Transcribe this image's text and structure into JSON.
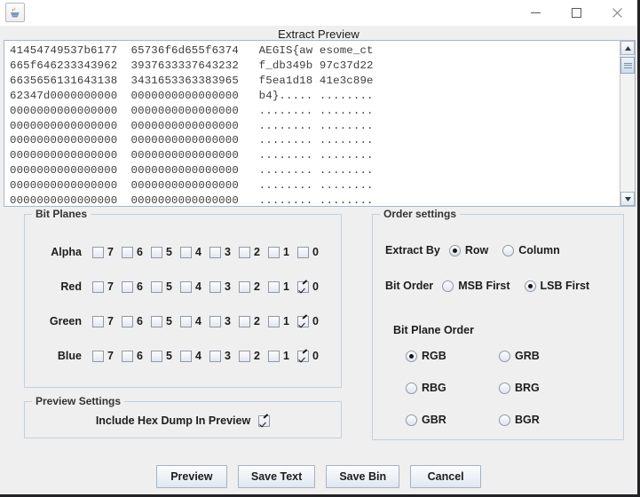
{
  "window": {
    "app_icon": "java-coffee-cup-icon",
    "title": "Extract Preview",
    "controls": {
      "minimize": "minimize-icon",
      "maximize": "maximize-icon",
      "close": "close-icon"
    }
  },
  "hexdump": {
    "lines": [
      "41454749537b6177  65736f6d655f6374   AEGIS{aw esome_ct",
      "665f646233343962  3937633337643232   f_db349b 97c37d22",
      "6635656131643138  3431653363383965   f5ea1d18 41e3c89e",
      "62347d0000000000  0000000000000000   b4}..... ........",
      "0000000000000000  0000000000000000   ........ ........",
      "0000000000000000  0000000000000000   ........ ........",
      "0000000000000000  0000000000000000   ........ ........",
      "0000000000000000  0000000000000000   ........ ........",
      "0000000000000000  0000000000000000   ........ ........",
      "0000000000000000  0000000000000000   ........ ........",
      "0000000000000000  0000000000000000   ........ ........"
    ],
    "scrollbar": {
      "up_arrow": "scroll-up-arrow-icon",
      "down_arrow": "scroll-down-arrow-icon"
    }
  },
  "bit_planes": {
    "legend": "Bit Planes",
    "bits": [
      "7",
      "6",
      "5",
      "4",
      "3",
      "2",
      "1",
      "0"
    ],
    "channels": [
      {
        "label": "Alpha",
        "checked": [
          false,
          false,
          false,
          false,
          false,
          false,
          false,
          false
        ]
      },
      {
        "label": "Red",
        "checked": [
          false,
          false,
          false,
          false,
          false,
          false,
          false,
          true
        ]
      },
      {
        "label": "Green",
        "checked": [
          false,
          false,
          false,
          false,
          false,
          false,
          false,
          true
        ]
      },
      {
        "label": "Blue",
        "checked": [
          false,
          false,
          false,
          false,
          false,
          false,
          false,
          true
        ]
      }
    ]
  },
  "order_settings": {
    "legend": "Order settings",
    "extract_by": {
      "label": "Extract By",
      "options": [
        "Row",
        "Column"
      ],
      "selected": "Row"
    },
    "bit_order": {
      "label": "Bit Order",
      "options": [
        "MSB First",
        "LSB First"
      ],
      "selected": "LSB First"
    },
    "bit_plane_order": {
      "label": "Bit Plane Order",
      "options": [
        "RGB",
        "GRB",
        "RBG",
        "BRG",
        "GBR",
        "BGR"
      ],
      "selected": "RGB"
    }
  },
  "preview_settings": {
    "legend": "Preview Settings",
    "include_hex_dump": {
      "label": "Include Hex Dump In Preview",
      "checked": true
    }
  },
  "buttons": [
    {
      "label": "Preview"
    },
    {
      "label": "Save Text"
    },
    {
      "label": "Save Bin"
    },
    {
      "label": "Cancel"
    }
  ],
  "colors": {
    "window_background": "#efefef",
    "panel_border": "#c3d0e0",
    "text_area_background": "#ffffff",
    "text_color": "#1d1d1d",
    "hex_text_color": "#3d3d3d"
  }
}
